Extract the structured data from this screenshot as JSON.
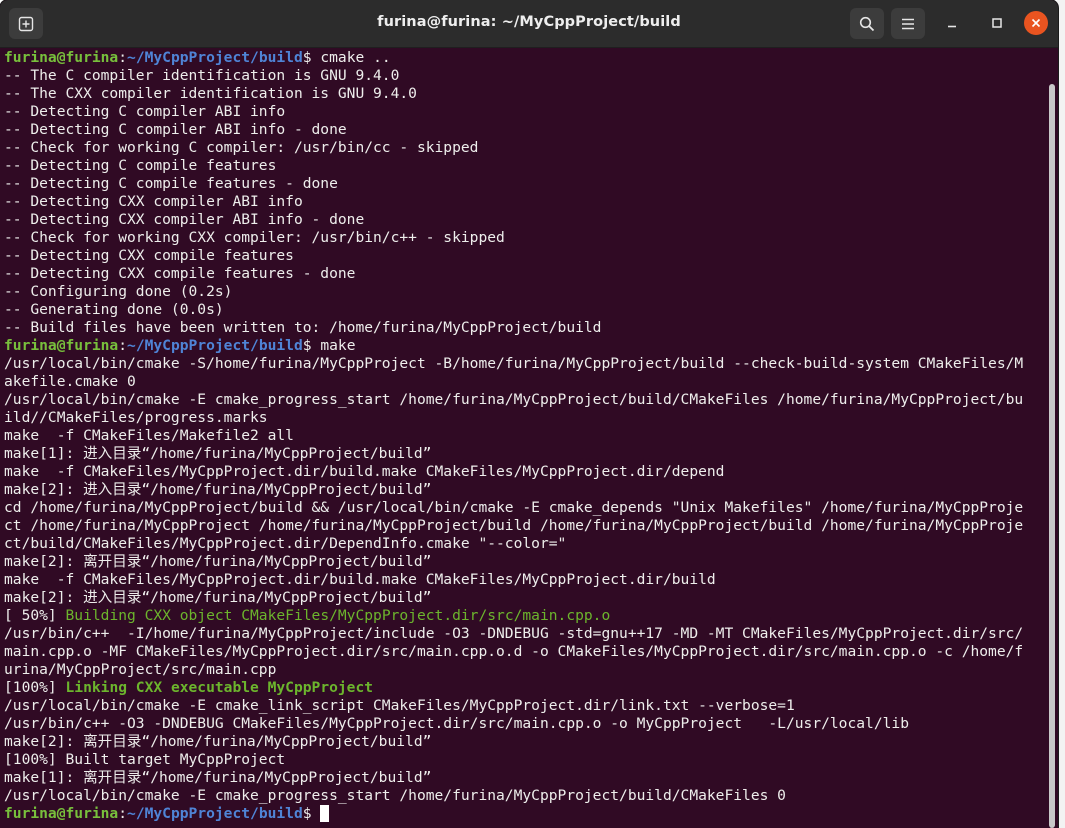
{
  "window": {
    "title": "furina@furina: ~/MyCppProject/build",
    "icons": {
      "new_tab": "new-tab-icon",
      "search": "search-icon",
      "menu": "hamburger-menu-icon",
      "minimize": "minimize-icon",
      "maximize": "maximize-icon",
      "close": "close-icon"
    }
  },
  "colors": {
    "background": "#300a24",
    "prompt_user": "#78c03c",
    "prompt_path": "#4f84d6",
    "close_button": "#e95420"
  },
  "prompt": {
    "user_host": "furina@furina",
    "sep": ":",
    "path": "~/MyCppProject/build",
    "symbol": "$"
  },
  "terminal": {
    "lines": [
      {
        "kind": "prompt",
        "cmd": " cmake .."
      },
      {
        "kind": "text",
        "text": "-- The C compiler identification is GNU 9.4.0"
      },
      {
        "kind": "text",
        "text": "-- The CXX compiler identification is GNU 9.4.0"
      },
      {
        "kind": "text",
        "text": "-- Detecting C compiler ABI info"
      },
      {
        "kind": "text",
        "text": "-- Detecting C compiler ABI info - done"
      },
      {
        "kind": "text",
        "text": "-- Check for working C compiler: /usr/bin/cc - skipped"
      },
      {
        "kind": "text",
        "text": "-- Detecting C compile features"
      },
      {
        "kind": "text",
        "text": "-- Detecting C compile features - done"
      },
      {
        "kind": "text",
        "text": "-- Detecting CXX compiler ABI info"
      },
      {
        "kind": "text",
        "text": "-- Detecting CXX compiler ABI info - done"
      },
      {
        "kind": "text",
        "text": "-- Check for working CXX compiler: /usr/bin/c++ - skipped"
      },
      {
        "kind": "text",
        "text": "-- Detecting CXX compile features"
      },
      {
        "kind": "text",
        "text": "-- Detecting CXX compile features - done"
      },
      {
        "kind": "text",
        "text": "-- Configuring done (0.2s)"
      },
      {
        "kind": "text",
        "text": "-- Generating done (0.0s)"
      },
      {
        "kind": "text",
        "text": "-- Build files have been written to: /home/furina/MyCppProject/build"
      },
      {
        "kind": "prompt",
        "cmd": " make"
      },
      {
        "kind": "text",
        "text": "/usr/local/bin/cmake -S/home/furina/MyCppProject -B/home/furina/MyCppProject/build --check-build-system CMakeFiles/M"
      },
      {
        "kind": "text",
        "text": "akefile.cmake 0"
      },
      {
        "kind": "text",
        "text": "/usr/local/bin/cmake -E cmake_progress_start /home/furina/MyCppProject/build/CMakeFiles /home/furina/MyCppProject/bu"
      },
      {
        "kind": "text",
        "text": "ild//CMakeFiles/progress.marks"
      },
      {
        "kind": "text",
        "text": "make  -f CMakeFiles/Makefile2 all"
      },
      {
        "kind": "text",
        "text": "make[1]: 进入目录“/home/furina/MyCppProject/build”"
      },
      {
        "kind": "text",
        "text": "make  -f CMakeFiles/MyCppProject.dir/build.make CMakeFiles/MyCppProject.dir/depend"
      },
      {
        "kind": "text",
        "text": "make[2]: 进入目录“/home/furina/MyCppProject/build”"
      },
      {
        "kind": "text",
        "text": "cd /home/furina/MyCppProject/build && /usr/local/bin/cmake -E cmake_depends \"Unix Makefiles\" /home/furina/MyCppProje"
      },
      {
        "kind": "text",
        "text": "ct /home/furina/MyCppProject /home/furina/MyCppProject/build /home/furina/MyCppProject/build /home/furina/MyCppProje"
      },
      {
        "kind": "text",
        "text": "ct/build/CMakeFiles/MyCppProject.dir/DependInfo.cmake \"--color=\""
      },
      {
        "kind": "text",
        "text": "make[2]: 离开目录“/home/furina/MyCppProject/build”"
      },
      {
        "kind": "text",
        "text": "make  -f CMakeFiles/MyCppProject.dir/build.make CMakeFiles/MyCppProject.dir/build"
      },
      {
        "kind": "text",
        "text": "make[2]: 进入目录“/home/furina/MyCppProject/build”"
      },
      {
        "kind": "split",
        "pre": "[ 50%] ",
        "post": "Building CXX object CMakeFiles/MyCppProject.dir/src/main.cpp.o",
        "bold": false
      },
      {
        "kind": "text",
        "text": "/usr/bin/c++  -I/home/furina/MyCppProject/include -O3 -DNDEBUG -std=gnu++17 -MD -MT CMakeFiles/MyCppProject.dir/src/"
      },
      {
        "kind": "text",
        "text": "main.cpp.o -MF CMakeFiles/MyCppProject.dir/src/main.cpp.o.d -o CMakeFiles/MyCppProject.dir/src/main.cpp.o -c /home/f"
      },
      {
        "kind": "text",
        "text": "urina/MyCppProject/src/main.cpp"
      },
      {
        "kind": "split",
        "pre": "[100%] ",
        "post": "Linking CXX executable MyCppProject",
        "bold": true
      },
      {
        "kind": "text",
        "text": "/usr/local/bin/cmake -E cmake_link_script CMakeFiles/MyCppProject.dir/link.txt --verbose=1"
      },
      {
        "kind": "text",
        "text": "/usr/bin/c++ -O3 -DNDEBUG CMakeFiles/MyCppProject.dir/src/main.cpp.o -o MyCppProject   -L/usr/local/lib"
      },
      {
        "kind": "text",
        "text": "make[2]: 离开目录“/home/furina/MyCppProject/build”"
      },
      {
        "kind": "text",
        "text": "[100%] Built target MyCppProject"
      },
      {
        "kind": "text",
        "text": "make[1]: 离开目录“/home/furina/MyCppProject/build”"
      },
      {
        "kind": "text",
        "text": "/usr/local/bin/cmake -E cmake_progress_start /home/furina/MyCppProject/build/CMakeFiles 0"
      },
      {
        "kind": "prompt",
        "cmd": " ",
        "cursor": true
      }
    ]
  }
}
